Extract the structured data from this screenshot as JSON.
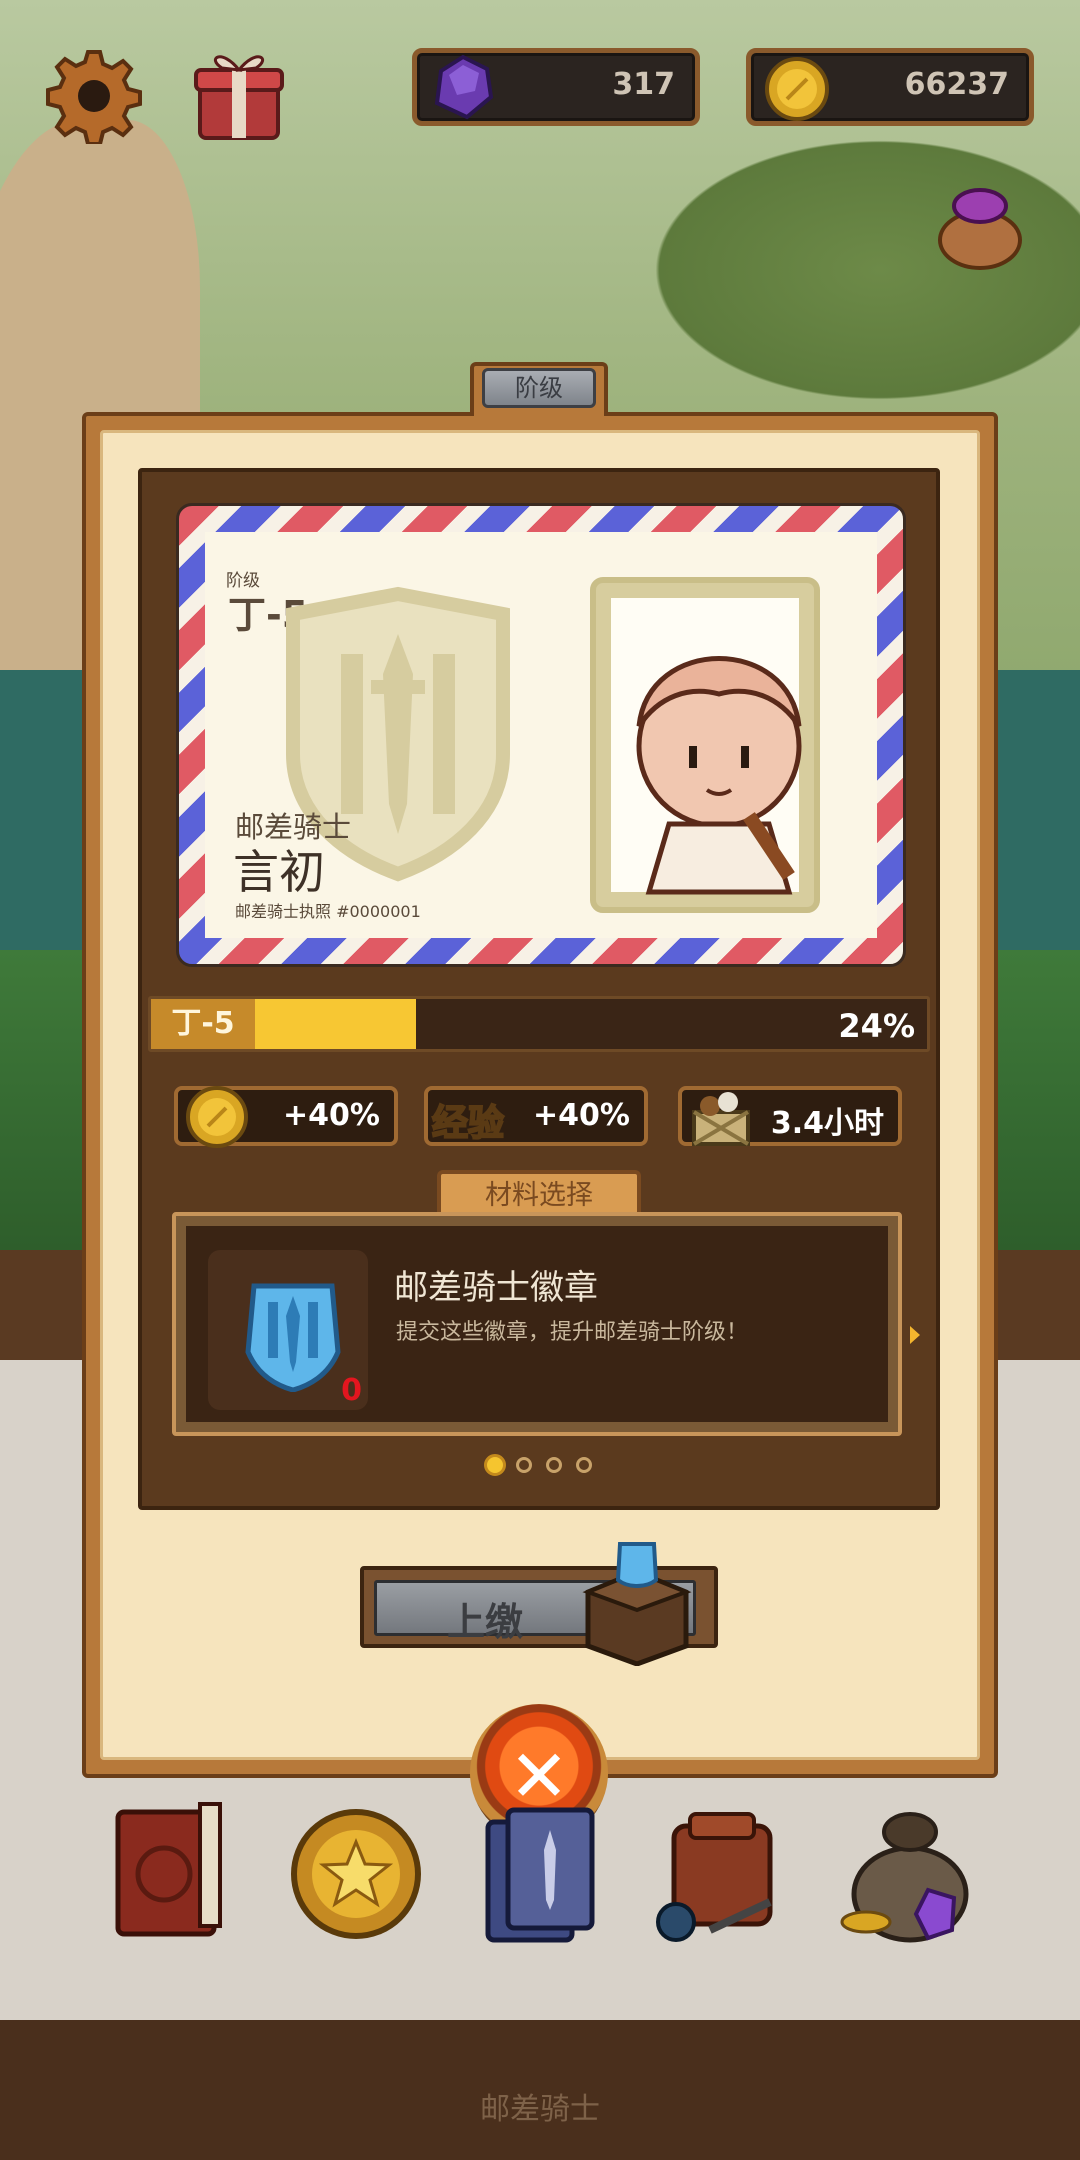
{
  "hud": {
    "gems": "317",
    "coins": "66237"
  },
  "dialog": {
    "title": "阶级",
    "card": {
      "rank_label": "阶级",
      "rank_value": "丁-5",
      "knight_title": "邮差骑士",
      "knight_name": "言初",
      "license": "邮差骑士执照 #0000001"
    },
    "progress": {
      "tier": "丁-5",
      "percent_text": "24%",
      "percent": 24
    },
    "bonuses": [
      {
        "icon": "coin-icon",
        "value": "+40%"
      },
      {
        "label": "经验",
        "value": "+40%"
      },
      {
        "icon": "crate-icon",
        "value": "3.4小时"
      }
    ],
    "materials": {
      "tab_label": "材料选择",
      "item_title": "邮差骑士徽章",
      "item_desc": "提交这些徽章，提升邮差骑士阶级！",
      "item_count": "0",
      "pages": 4,
      "active_page": 1
    },
    "submit_label": "上缴"
  },
  "bottom": {
    "label": "邮差骑士",
    "nav_icons": [
      "book-icon",
      "coin-medal-icon",
      "card-icon",
      "backpack-icon",
      "treasure-bag-icon"
    ]
  },
  "colors": {
    "accent_gold": "#f7c733",
    "panel_brown": "#5b3a1e",
    "count_red": "#e3161f"
  }
}
